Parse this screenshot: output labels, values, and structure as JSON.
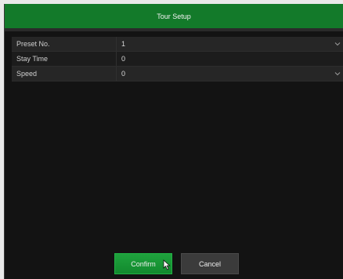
{
  "dialog": {
    "title": "Tour Setup"
  },
  "form": {
    "rows": [
      {
        "label": "Preset No.",
        "value": "1",
        "has_dropdown": true
      },
      {
        "label": "Stay Time",
        "value": "0",
        "has_dropdown": false
      },
      {
        "label": "Speed",
        "value": "0",
        "has_dropdown": true
      }
    ]
  },
  "buttons": {
    "confirm_label": "Confirm",
    "cancel_label": "Cancel"
  },
  "icons": {
    "dropdown": "chevron-down-icon",
    "cursor": "mouse-pointer-icon"
  },
  "colors": {
    "title_bar": "#137a2a",
    "confirm_button": "#1a9836",
    "background": "#131313"
  }
}
